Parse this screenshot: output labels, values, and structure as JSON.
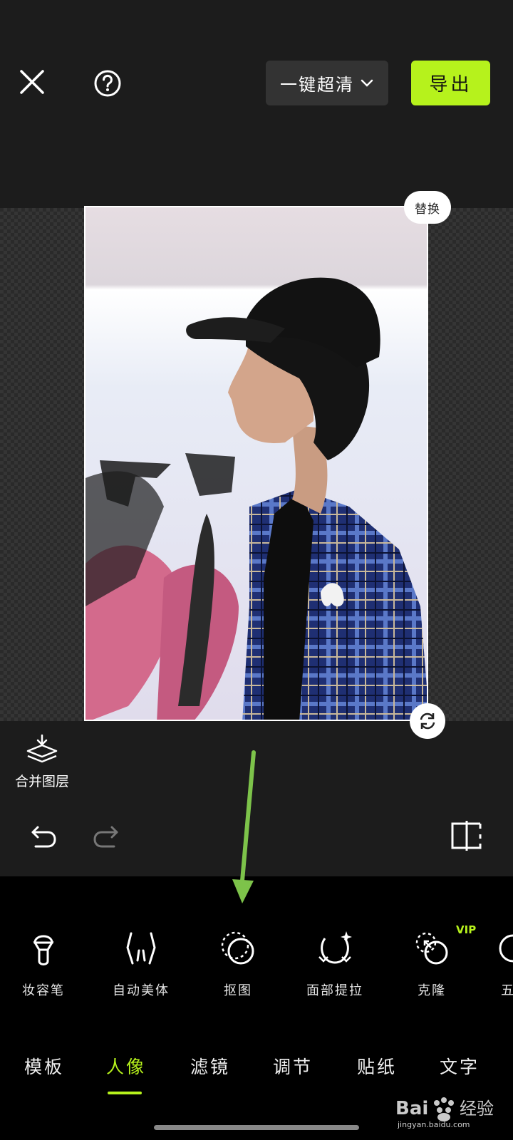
{
  "header": {
    "close_icon": "close-icon",
    "help_icon": "help-icon",
    "enhance_label": "一键超清",
    "export_label": "导出"
  },
  "canvas": {
    "replace_label": "替换",
    "rotate_icon": "rotate-icon"
  },
  "layers": {
    "merge_label": "合并图层"
  },
  "tools": [
    {
      "label": "妆容笔",
      "icon": "makeup-brush-icon"
    },
    {
      "label": "自动美体",
      "icon": "body-shape-icon"
    },
    {
      "label": "抠图",
      "icon": "cutout-icon"
    },
    {
      "label": "面部提拉",
      "icon": "face-lift-icon"
    },
    {
      "label": "克隆",
      "icon": "clone-icon",
      "badge": "VIP"
    },
    {
      "label": "五",
      "icon": "features-icon"
    }
  ],
  "tabs": [
    {
      "label": "模板"
    },
    {
      "label": "人像",
      "active": true
    },
    {
      "label": "滤镜"
    },
    {
      "label": "调节"
    },
    {
      "label": "贴纸"
    },
    {
      "label": "文字"
    }
  ],
  "watermark": {
    "brand": "Bai",
    "brand2": "经验",
    "url": "jingyan.baidu.com"
  },
  "colors": {
    "accent": "#b6f21c",
    "background": "#1c1c1c",
    "arrow": "#7dc34a"
  }
}
